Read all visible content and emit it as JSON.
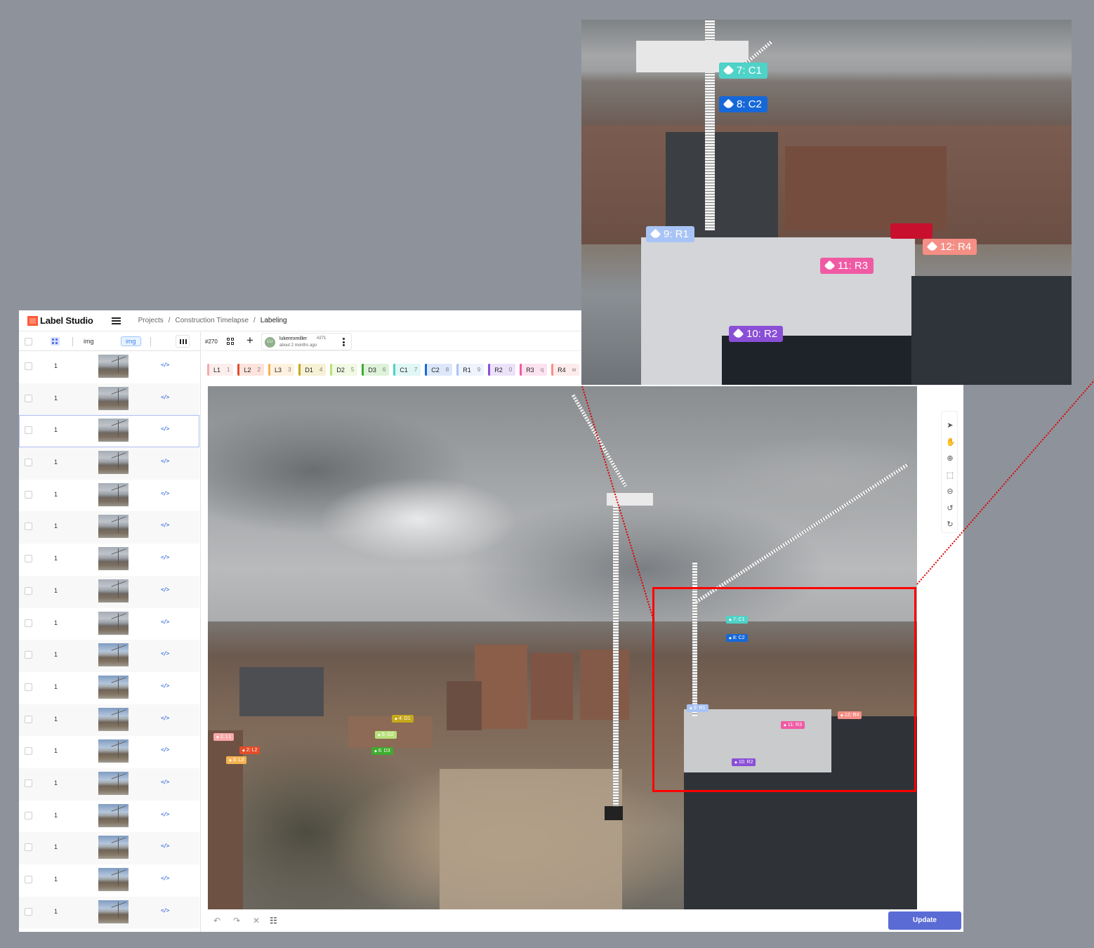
{
  "app": {
    "name": "Label Studio"
  },
  "breadcrumb": [
    "Projects",
    "/",
    "Construction Timelapse",
    "/",
    "Labeling"
  ],
  "table": {
    "headers": {
      "img": "img",
      "img_badge": "img"
    },
    "rows": [
      {
        "num": "1",
        "code": "</>"
      },
      {
        "num": "1",
        "code": "</>"
      },
      {
        "num": "1",
        "code": "</>"
      },
      {
        "num": "1",
        "code": "</>"
      },
      {
        "num": "1",
        "code": "</>"
      },
      {
        "num": "1",
        "code": "</>"
      },
      {
        "num": "1",
        "code": "</>"
      },
      {
        "num": "1",
        "code": "</>"
      },
      {
        "num": "1",
        "code": "</>"
      },
      {
        "num": "1",
        "code": "</>"
      },
      {
        "num": "1",
        "code": "</>"
      },
      {
        "num": "1",
        "code": "</>"
      },
      {
        "num": "1",
        "code": "</>"
      },
      {
        "num": "1",
        "code": "</>"
      },
      {
        "num": "1",
        "code": "</>"
      },
      {
        "num": "1",
        "code": "</>"
      },
      {
        "num": "1",
        "code": "</>"
      },
      {
        "num": "1",
        "code": "</>"
      }
    ]
  },
  "annotation": {
    "task_id": "#270",
    "user": "lukerexmiller",
    "user_id": "#271",
    "time": "about 2 months ago",
    "avatar": "LU"
  },
  "labels": [
    {
      "name": "L1",
      "hotkey": "1",
      "color": "#f9a8a8",
      "bg": "#fdeeee"
    },
    {
      "name": "L2",
      "hotkey": "2",
      "color": "#e34d2a",
      "bg": "#fde3dc"
    },
    {
      "name": "L3",
      "hotkey": "3",
      "color": "#f5b352",
      "bg": "#fef2df"
    },
    {
      "name": "D1",
      "hotkey": "4",
      "color": "#c6a81a",
      "bg": "#f7f1d5"
    },
    {
      "name": "D2",
      "hotkey": "5",
      "color": "#b9e07a",
      "bg": "#f1f9e4"
    },
    {
      "name": "D3",
      "hotkey": "6",
      "color": "#3eab2d",
      "bg": "#def2da"
    },
    {
      "name": "C1",
      "hotkey": "7",
      "color": "#4fd2c8",
      "bg": "#e0f7f5"
    },
    {
      "name": "C2",
      "hotkey": "8",
      "color": "#1668d8",
      "bg": "#dce8fa"
    },
    {
      "name": "R1",
      "hotkey": "9",
      "color": "#a8c3f5",
      "bg": "#eef3fd"
    },
    {
      "name": "R2",
      "hotkey": "0",
      "color": "#8a4fd6",
      "bg": "#ece2f9"
    },
    {
      "name": "R3",
      "hotkey": "q",
      "color": "#f05aa4",
      "bg": "#fde3ef"
    },
    {
      "name": "R4",
      "hotkey": "w",
      "color": "#f58f85",
      "bg": "#fdeceb"
    }
  ],
  "regions": [
    {
      "label": "1: L1",
      "color": "#f9a8a8"
    },
    {
      "label": "2: L2",
      "color": "#e34d2a"
    },
    {
      "label": "3: L3",
      "color": "#f5b352"
    },
    {
      "label": "4: D1",
      "color": "#c6a81a"
    },
    {
      "label": "5: D2",
      "color": "#b9e07a"
    },
    {
      "label": "6: D3",
      "color": "#3eab2d"
    },
    {
      "label": "7: C1",
      "color": "#4fd2c8"
    },
    {
      "label": "8: C2",
      "color": "#1668d8"
    },
    {
      "label": "9: R1",
      "color": "#a8c3f5"
    },
    {
      "label": "10: R2",
      "color": "#8a4fd6"
    },
    {
      "label": "11: R3",
      "color": "#f05aa4"
    },
    {
      "label": "12: R4",
      "color": "#f58f85"
    }
  ],
  "tools": [
    "pointer-icon",
    "hand-icon",
    "zoom-in-icon",
    "fit-icon",
    "zoom-out-icon",
    "rotate-left-icon",
    "rotate-right-icon"
  ],
  "bottom": {
    "update_label": "Update"
  },
  "colors": {
    "accent": "#5b6bd5",
    "highlight_box": "#ff0000"
  }
}
